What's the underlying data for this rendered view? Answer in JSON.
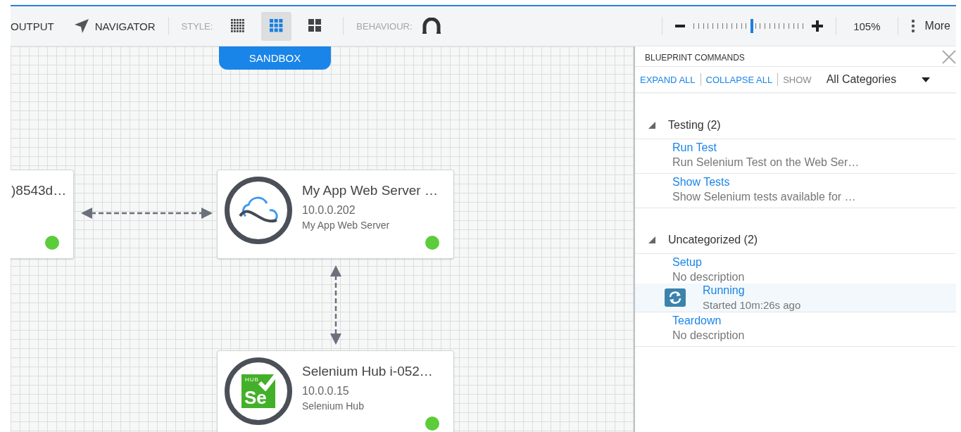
{
  "toolbar": {
    "output": "OUTPUT",
    "navigator": "NAVIGATOR",
    "style_label": "STYLE:",
    "styles": [
      {
        "kind": "fine",
        "selected": false
      },
      {
        "kind": "medium",
        "selected": true
      },
      {
        "kind": "large",
        "selected": false
      }
    ],
    "behaviour_label": "BEHAVIOUR:",
    "zoom": {
      "level": 0.53,
      "reading": "105%"
    },
    "more": "More"
  },
  "canvas": {
    "tab": "SANDBOX",
    "nodes": [
      {
        "kind": "cut",
        "title": ")8543d…",
        "online": true
      },
      {
        "kind": "cloud",
        "title": "My App Web Server …",
        "address": "10.0.0.202",
        "subtitle": "My App Web Server",
        "online": true
      },
      {
        "kind": "selenium",
        "title": "Selenium Hub i-052…",
        "address": "10.0.0.15",
        "subtitle": "Selenium Hub",
        "logo_small": "HUB",
        "logo_big": "Se",
        "online": true
      }
    ]
  },
  "panel": {
    "title": "BLUEPRINT COMMANDS",
    "expand_all": "EXPAND ALL",
    "collapse_all": "COLLAPSE ALL",
    "show_label": "SHOW",
    "show_value": "All Categories",
    "categories": [
      {
        "name": "Testing (2)",
        "expanded": true,
        "commands": [
          {
            "kind": "command",
            "name": "Run Test",
            "description": "Run Selenium Test on the Web Ser…"
          },
          {
            "kind": "command",
            "name": "Show Tests",
            "description": "Show Selenium tests available for …"
          }
        ]
      },
      {
        "name": "Uncategorized (2)",
        "expanded": true,
        "commands": [
          {
            "kind": "command",
            "name": "Setup",
            "description": "No description"
          },
          {
            "kind": "running",
            "name": "Running",
            "description": "Started 10m:26s ago"
          },
          {
            "kind": "command",
            "name": "Teardown",
            "description": "No description"
          }
        ]
      }
    ]
  }
}
